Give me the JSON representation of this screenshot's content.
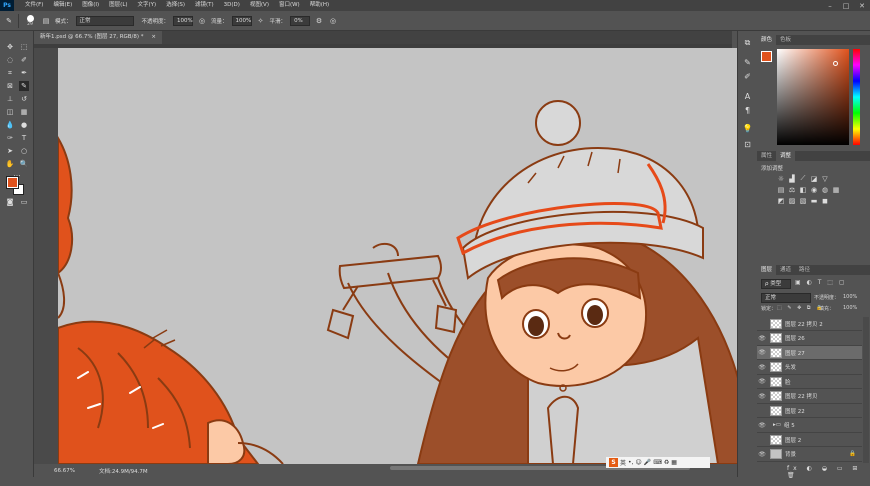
{
  "menubar": {
    "logo": "Ps",
    "items": [
      "文件(F)",
      "编辑(E)",
      "图像(I)",
      "图层(L)",
      "文字(Y)",
      "选择(S)",
      "滤镜(T)",
      "3D(D)",
      "视图(V)",
      "窗口(W)",
      "帮助(H)"
    ],
    "minimize": "–",
    "maximize": "□",
    "close": "✕"
  },
  "options": {
    "brush_size": "29",
    "mode_label": "模式：",
    "mode_value": "正常",
    "opacity_label": "不透明度：",
    "opacity_value": "100%",
    "flow_label": "流量：",
    "flow_value": "100%",
    "smooth_label": "平滑：",
    "smooth_value": "0%"
  },
  "document": {
    "tab_title": "新年1.psd @ 66.7% (图层 27, RGB/8) *",
    "tab_close": "×"
  },
  "status": {
    "zoom": "66.67%",
    "doc_info": "文档:24.9M/94.7M"
  },
  "ime": {
    "logo": "S",
    "mode": "英"
  },
  "panels": {
    "color_tabs": [
      "颜色",
      "色板"
    ],
    "props_tabs": [
      "属性",
      "调整"
    ],
    "adjust_title": "添加调整",
    "layers_tabs": [
      "图层",
      "通道",
      "路径"
    ],
    "kind_label": "ρ 类型",
    "blend_mode": "正常",
    "opacity_label": "不透明度：",
    "opacity_value": "100%",
    "lock_label": "锁定：",
    "fill_label": "填充：",
    "fill_value": "100%",
    "layers": [
      {
        "name": "图层 22 拷贝 2",
        "visible": false
      },
      {
        "name": "图层 26",
        "visible": true
      },
      {
        "name": "图层 27",
        "visible": true,
        "selected": true
      },
      {
        "name": "头发",
        "visible": true
      },
      {
        "name": "脸",
        "visible": true
      },
      {
        "name": "图层 22 拷贝",
        "visible": true
      },
      {
        "name": "图层 22",
        "visible": false
      },
      {
        "name": "组 5",
        "visible": true,
        "group": true
      },
      {
        "name": "图层 2",
        "visible": false
      },
      {
        "name": "背景",
        "visible": true,
        "locked": true
      }
    ]
  },
  "colors": {
    "foreground": "#e0521c",
    "background": "#ffffff",
    "line": "#8a3b12",
    "skin": "#fcc9a6",
    "hair": "#9c4f2a",
    "canvas": "#c4c4c4",
    "orange_stroke": "#e64a19"
  }
}
